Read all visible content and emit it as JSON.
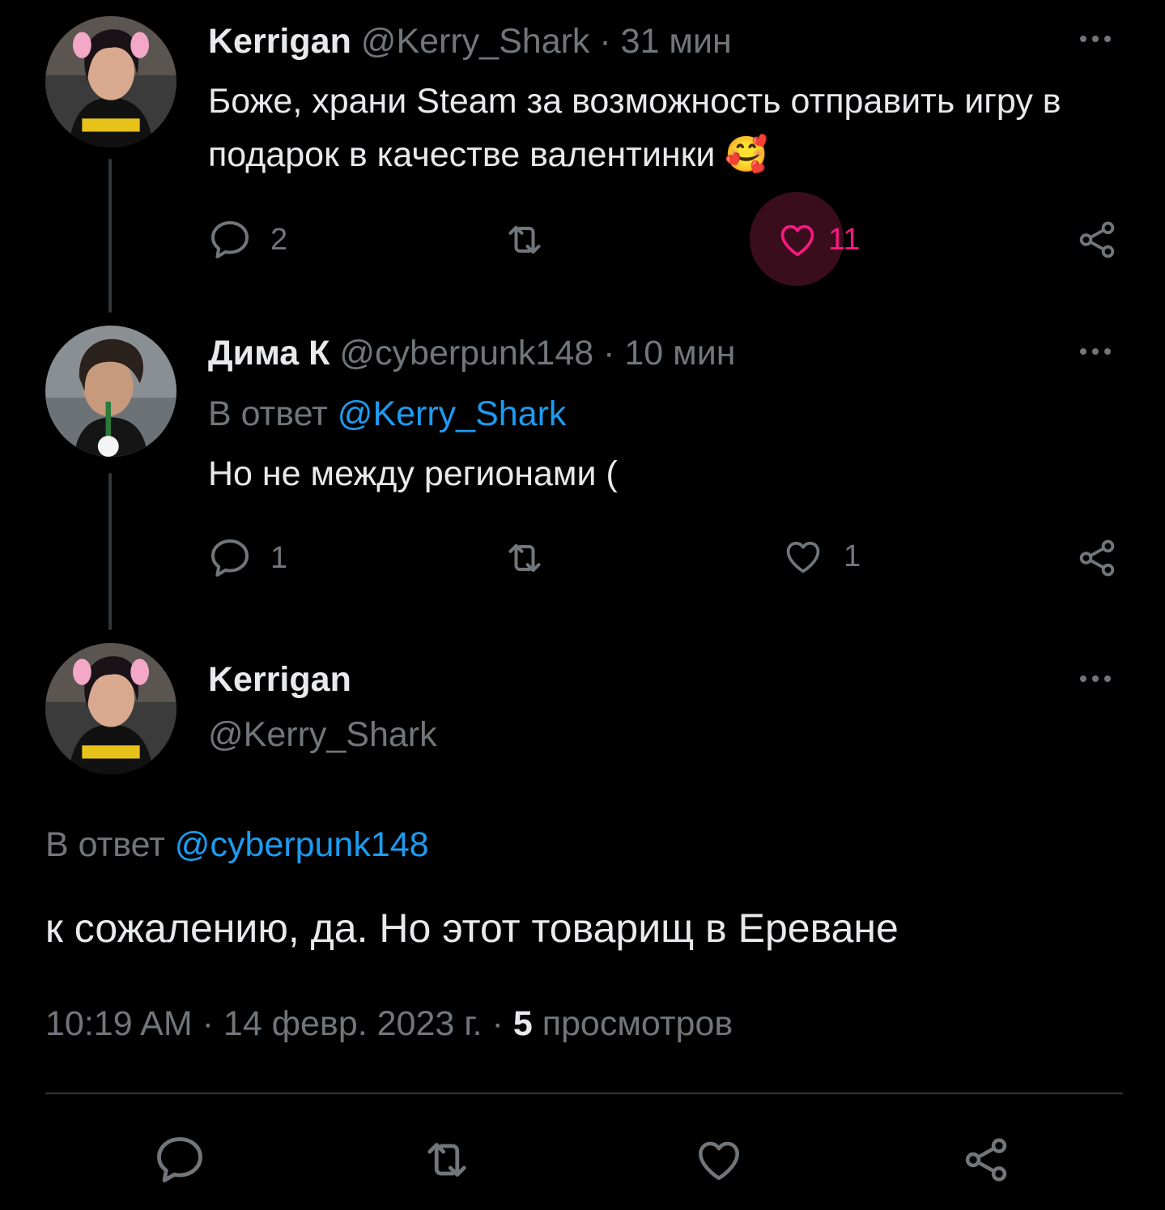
{
  "tweets": [
    {
      "name": "Kerrigan",
      "handle": "@Kerry_Shark",
      "time": "· 31 мин",
      "text": "Боже, храни Steam за возможность отправить игру в подарок в качестве валентинки 🥰",
      "replies": "2",
      "likes": "11",
      "liked": true
    },
    {
      "name": "Дима К",
      "handle": "@cyberpunk148",
      "time": "· 10 мин",
      "reply_prefix": "В ответ",
      "reply_to": "@Kerry_Shark",
      "text": "Но не между регионами (",
      "replies": "1",
      "likes": "1",
      "liked": false
    }
  ],
  "main": {
    "name": "Kerrigan",
    "handle": "@Kerry_Shark",
    "reply_prefix": "В ответ",
    "reply_to": "@cyberpunk148",
    "text": "к сожалению, да. Но этот товарищ в Ереване",
    "time": "10:19 AM",
    "date": "· 14 февр. 2023 г. ·",
    "views_count": "5",
    "views_label": "просмотров"
  },
  "colors": {
    "background": "#000000",
    "text": "#e7e9ea",
    "muted": "#71767b",
    "link": "#1d9bf0",
    "like": "#f91880"
  },
  "icons": [
    "reply-icon",
    "retweet-icon",
    "like-icon",
    "share-icon",
    "more-icon"
  ]
}
